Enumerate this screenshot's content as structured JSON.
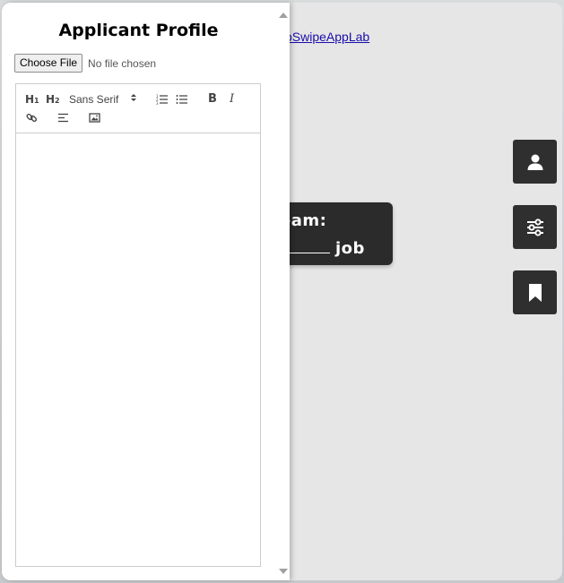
{
  "background": {
    "link_text": "oSwipeAppLab",
    "card": {
      "line1": "eam:",
      "line2_suffix": "job"
    }
  },
  "side_buttons": [
    {
      "icon": "person-icon"
    },
    {
      "icon": "sliders-icon"
    },
    {
      "icon": "bookmark-icon"
    }
  ],
  "panel": {
    "title": "Applicant Profile",
    "file_button": "Choose File",
    "file_status": "No file chosen",
    "toolbar": {
      "h1": "H",
      "h1_sub": "1",
      "h2": "H",
      "h2_sub": "2",
      "font": "Sans Serif",
      "bold": "B",
      "italic": "I"
    }
  },
  "colors": {
    "dark_button": "#2f2f2f",
    "link": "#1a0dab",
    "card": "#2b2b2b"
  }
}
